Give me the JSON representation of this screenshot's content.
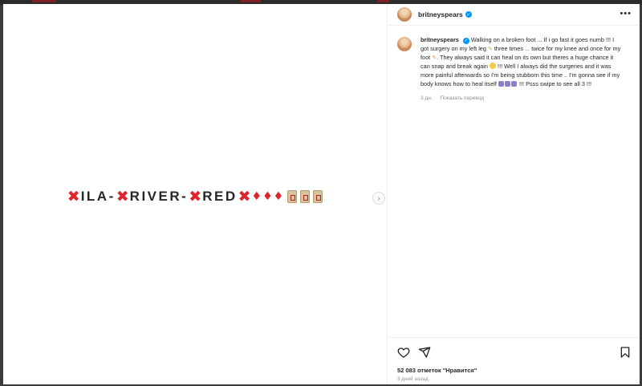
{
  "post": {
    "username": "britneyspears",
    "media_text": {
      "segments": [
        "ILA-",
        "RIVER-",
        "RED"
      ]
    },
    "caption": {
      "username": "britneyspears",
      "line1": "Walking on a broken foot ... If i go fast it goes numb !!! I got surgery on my left leg",
      "line2": "three times ... twice for my knee and once for my foot",
      "line3": ". They always said it can heal on its own but theres a huge chance it can snap and break again",
      "line4": "!!! Well I always did the surgeries and it was more painful afterwards so I'm being stubborn this time .. I'm gonna see if my body knows how to heal itself",
      "line5": "!!! Psss swipe to see all 3 !!!"
    },
    "meta": {
      "time": "3 дн.",
      "translate": "Показать перевод"
    },
    "likes": "52 083 отметок \"Нравится\"",
    "time_ago": "3 дней назад"
  },
  "icons": {
    "more": "more-icon",
    "like": "heart-icon",
    "share": "send-icon",
    "save": "bookmark-icon",
    "next": "chevron-right-icon"
  },
  "colors": {
    "accent_red": "#e0242e",
    "verified_blue": "#0095f6",
    "secondary_text": "#8e8e8e"
  }
}
